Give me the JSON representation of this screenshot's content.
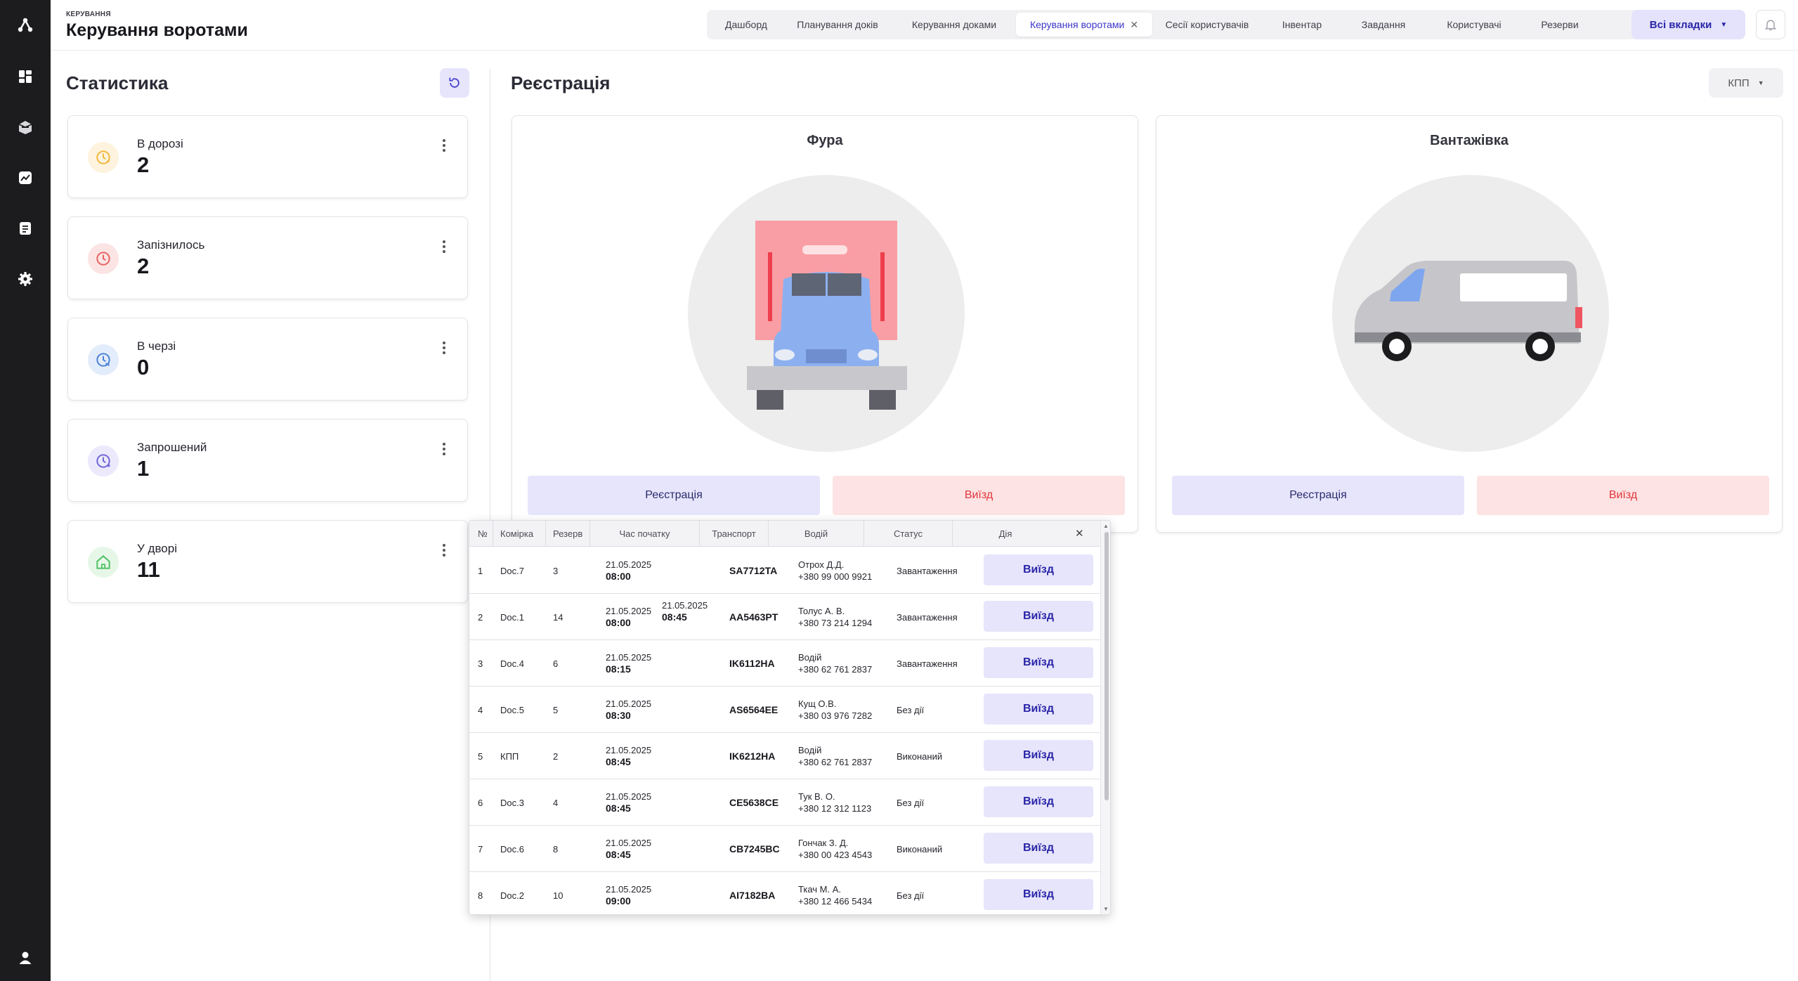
{
  "header": {
    "breadcrumb": "КЕРУВАННЯ",
    "title": "Керування воротами",
    "tabs": [
      {
        "label": "Дашборд"
      },
      {
        "label": "Планування доків"
      },
      {
        "label": "Керування доками"
      },
      {
        "label": "Керування воротами"
      },
      {
        "label": "Сесії користувачів"
      },
      {
        "label": "Інвентар"
      },
      {
        "label": "Завдання"
      },
      {
        "label": "Користувачі"
      },
      {
        "label": "Резерви"
      }
    ],
    "active_tab": "Керування воротами",
    "all_tabs_label": "Всі вкладки"
  },
  "sidebar": {
    "icons": [
      "logo-icon",
      "dashboard-icon",
      "inventory-box-icon",
      "analytics-chart-icon",
      "document-list-icon",
      "settings-gear-icon",
      "user-profile-icon"
    ]
  },
  "stats": {
    "title": "Статистика",
    "cards": [
      {
        "label": "В дорозі",
        "value": "2",
        "color": "#f3b63a",
        "bg": "#fdf3de"
      },
      {
        "label": "Запізнилось",
        "value": "2",
        "color": "#e8605e",
        "bg": "#fce4e4"
      },
      {
        "label": "В черзі",
        "value": "0",
        "color": "#4a7fd6",
        "bg": "#e3ecfa"
      },
      {
        "label": "Запрошений",
        "value": "1",
        "color": "#6e63d9",
        "bg": "#ebe9fb"
      },
      {
        "label": "У дворі",
        "value": "11",
        "color": "#4cbf63",
        "bg": "#e6f7e8"
      }
    ]
  },
  "registration": {
    "title": "Реєстрація",
    "checkpoint": "КПП",
    "vehicles": [
      {
        "title": "Фура",
        "register_label": "Реєстрація",
        "exit_label": "Виїзд"
      },
      {
        "title": "Вантажівка",
        "register_label": "Реєстрація",
        "exit_label": "Виїзд"
      }
    ]
  },
  "table": {
    "columns": [
      "№",
      "Комірка",
      "Резерв",
      "Час початку",
      "Транспорт",
      "Водій",
      "Статус",
      "Дія"
    ],
    "action_label": "Виїзд",
    "rows": [
      {
        "n": "1",
        "cell": "Doc.7",
        "reserve": "3",
        "date": "21.05.2025",
        "time": "08:00",
        "date2": "",
        "time2": "",
        "plate": "SA7712TA",
        "driver": "Отрох Д.Д.",
        "phone": "+380 99 000 9921",
        "status": "Завантаження"
      },
      {
        "n": "2",
        "cell": "Doc.1",
        "reserve": "14",
        "date": "21.05.2025",
        "time": "08:00",
        "date2": "21.05.2025",
        "time2": "08:45",
        "plate": "AA5463PT",
        "driver": "Толус А. В.",
        "phone": "+380 73 214 1294",
        "status": "Завантаження"
      },
      {
        "n": "3",
        "cell": "Doc.4",
        "reserve": "6",
        "date": "21.05.2025",
        "time": "08:15",
        "date2": "",
        "time2": "",
        "plate": "IK6112HA",
        "driver": "Водій",
        "phone": "+380 62 761 2837",
        "status": "Завантаження"
      },
      {
        "n": "4",
        "cell": "Doc.5",
        "reserve": "5",
        "date": "21.05.2025",
        "time": "08:30",
        "date2": "",
        "time2": "",
        "plate": "AS6564EE",
        "driver": "Кущ О.В.",
        "phone": "+380 03 976 7282",
        "status": "Без дії"
      },
      {
        "n": "5",
        "cell": "КПП",
        "reserve": "2",
        "date": "21.05.2025",
        "time": "08:45",
        "date2": "",
        "time2": "",
        "plate": "IK6212HA",
        "driver": "Водій",
        "phone": "+380 62 761 2837",
        "status": "Виконаний"
      },
      {
        "n": "6",
        "cell": "Doc.3",
        "reserve": "4",
        "date": "21.05.2025",
        "time": "08:45",
        "date2": "",
        "time2": "",
        "plate": "CE5638CE",
        "driver": "Тук В. О.",
        "phone": "+380 12 312 1123",
        "status": "Без дії"
      },
      {
        "n": "7",
        "cell": "Doc.6",
        "reserve": "8",
        "date": "21.05.2025",
        "time": "08:45",
        "date2": "",
        "time2": "",
        "plate": "CB7245BC",
        "driver": "Гончак З. Д.",
        "phone": "+380 00 423 4543",
        "status": "Виконаний"
      },
      {
        "n": "8",
        "cell": "Doc.2",
        "reserve": "10",
        "date": "21.05.2025",
        "time": "09:00",
        "date2": "",
        "time2": "",
        "plate": "AI7182BA",
        "driver": "Ткач М. А.",
        "phone": "+380 12 466 5434",
        "status": "Без дії"
      }
    ]
  },
  "colors": {
    "accent": "#3b35c9",
    "accent_bg": "#e6e5fb",
    "danger": "#e0353b",
    "danger_bg": "#fde3e3",
    "sidebar": "#1c1c1e"
  }
}
